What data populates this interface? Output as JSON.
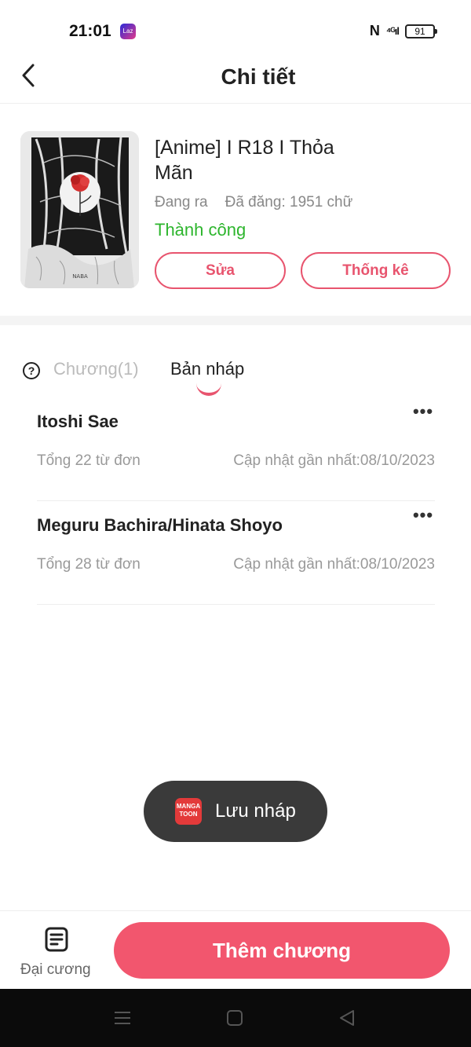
{
  "status_bar": {
    "time": "21:01",
    "app_badge": "Laz",
    "nfc": "N",
    "signal": "⁴ᴳıl",
    "battery": "91"
  },
  "header": {
    "title": "Chi tiết",
    "back_icon": "chevron-left-icon"
  },
  "work": {
    "title": "[Anime] I R18 I Thỏa Mãn",
    "state": "Đang ra",
    "posted": "Đã đăng: 1951 chữ",
    "status": "Thành công",
    "cover_signature": "NABA",
    "edit_label": "Sửa",
    "stats_label": "Thống kê",
    "status_color": "#2db52d",
    "accent_color": "#e8546e"
  },
  "tabs": {
    "help_icon": "question-circle-icon",
    "chapters_label": "Chương(1)",
    "drafts_label": "Bản nháp"
  },
  "drafts": [
    {
      "name": "Itoshi Sae",
      "count": "Tổng 22 từ đơn",
      "updated": "Cập nhật gần nhất:08/10/2023",
      "more_icon": "more-dots-icon"
    },
    {
      "name": "Meguru Bachira/Hinata Shoyo",
      "count": "Tổng 28 từ đơn",
      "updated": "Cập nhật gần nhất:08/10/2023",
      "more_icon": "more-dots-icon"
    }
  ],
  "toast": {
    "icon_text": "MANGA TOON",
    "text": "Lưu nháp"
  },
  "bottom": {
    "outline_label": "Đại cương",
    "add_chapter_label": "Thêm chương",
    "button_color": "#f2566e"
  },
  "navbar": {
    "icons": [
      "menu-icon",
      "home-icon",
      "back-triangle-icon"
    ]
  }
}
